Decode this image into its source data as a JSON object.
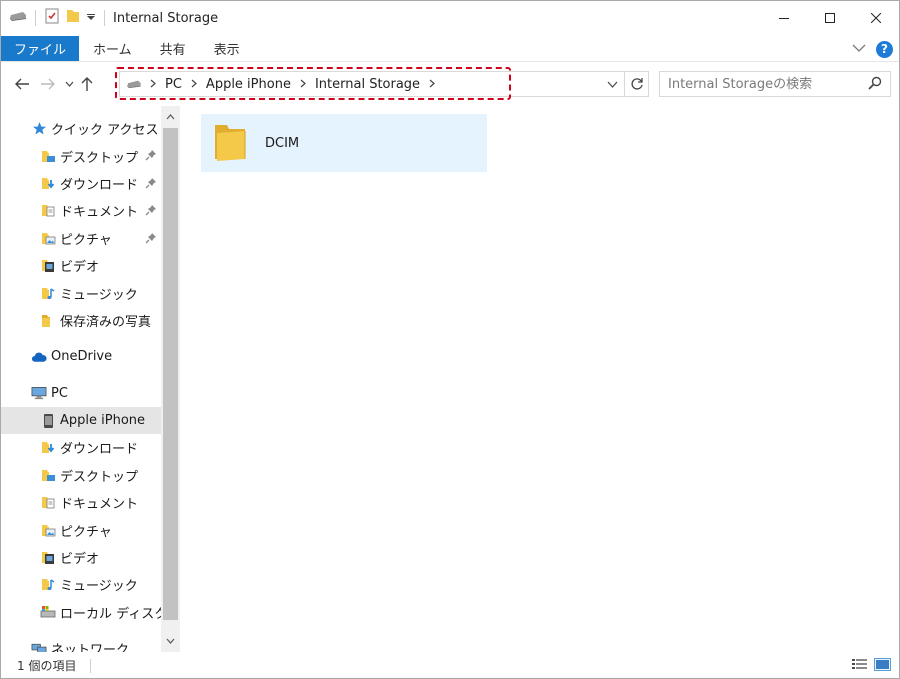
{
  "window": {
    "title": "Internal Storage"
  },
  "ribbon": {
    "tabs": [
      {
        "label": "ファイル"
      },
      {
        "label": "ホーム"
      },
      {
        "label": "共有"
      },
      {
        "label": "表示"
      }
    ]
  },
  "address": {
    "crumbs": [
      "PC",
      "Apple iPhone",
      "Internal Storage"
    ]
  },
  "search": {
    "placeholder": "Internal Storageの検索"
  },
  "sidebar": {
    "quick_access": {
      "label": "クイック アクセス",
      "items": [
        "デスクトップ",
        "ダウンロード",
        "ドキュメント",
        "ピクチャ",
        "ビデオ",
        "ミュージック",
        "保存済みの写真"
      ]
    },
    "onedrive": "OneDrive",
    "pc": {
      "label": "PC",
      "items": [
        "Apple iPhone",
        "ダウンロード",
        "デスクトップ",
        "ドキュメント",
        "ピクチャ",
        "ビデオ",
        "ミュージック",
        "ローカル ディスク (C"
      ]
    },
    "network": "ネットワーク"
  },
  "content": {
    "items": [
      {
        "name": "DCIM"
      }
    ]
  },
  "status": {
    "count_text": "1 個の項目"
  },
  "colors": {
    "accent": "#1979ca",
    "highlight_border": "#d0021b",
    "selection": "#e5f3fe",
    "folder": "#f4c94a"
  }
}
